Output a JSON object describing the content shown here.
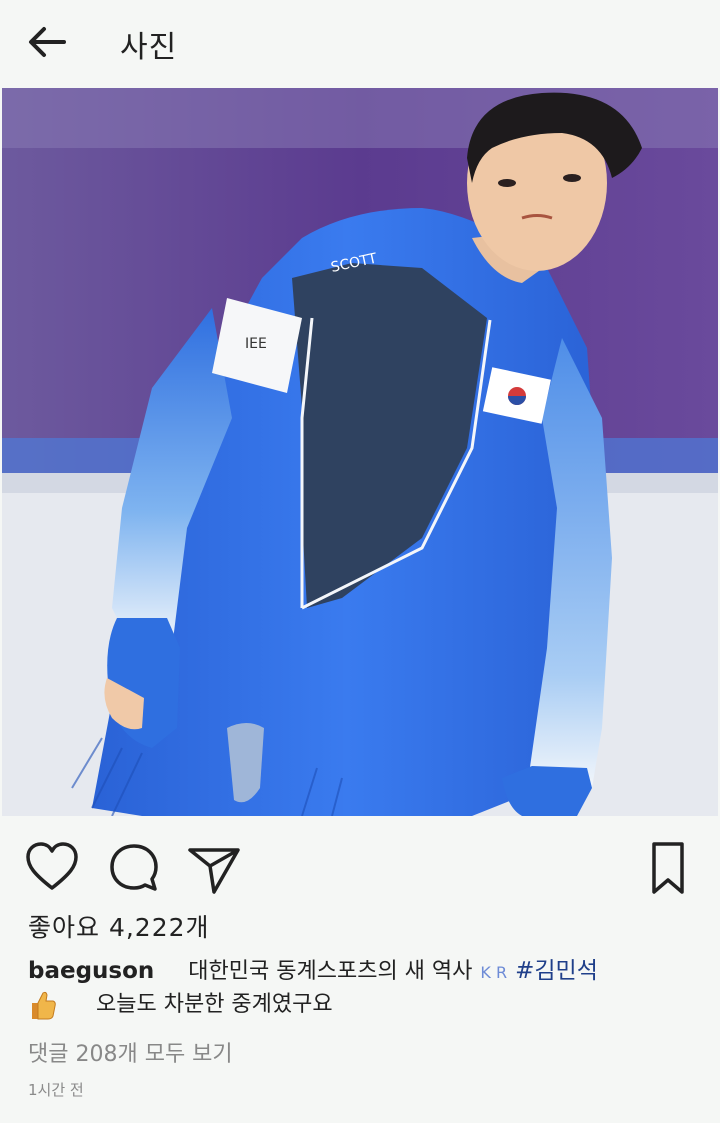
{
  "header": {
    "title": "사진"
  },
  "post": {
    "likes": "좋아요 4,222개",
    "username": "baeguson",
    "caption_text": "대한민국 동계스포츠의 새 역사",
    "caption_kr": "K R",
    "hashtag": "#김민석",
    "caption_line2": "오늘도 차분한 중계였구요",
    "comments_link": "댓글 208개 모두 보기",
    "timestamp": "1시간 전"
  },
  "icons": {
    "back": "arrow-left-icon",
    "like": "heart-icon",
    "comment": "comment-bubble-icon",
    "share": "paper-plane-icon",
    "save": "bookmark-icon",
    "emoji": "thumbs-up-icon"
  },
  "colors": {
    "suit_blue": "#2f6fe0",
    "background_purple": "#5b3b8f",
    "ice": "#e9ecf1",
    "hashtag": "#1f3f8a"
  }
}
